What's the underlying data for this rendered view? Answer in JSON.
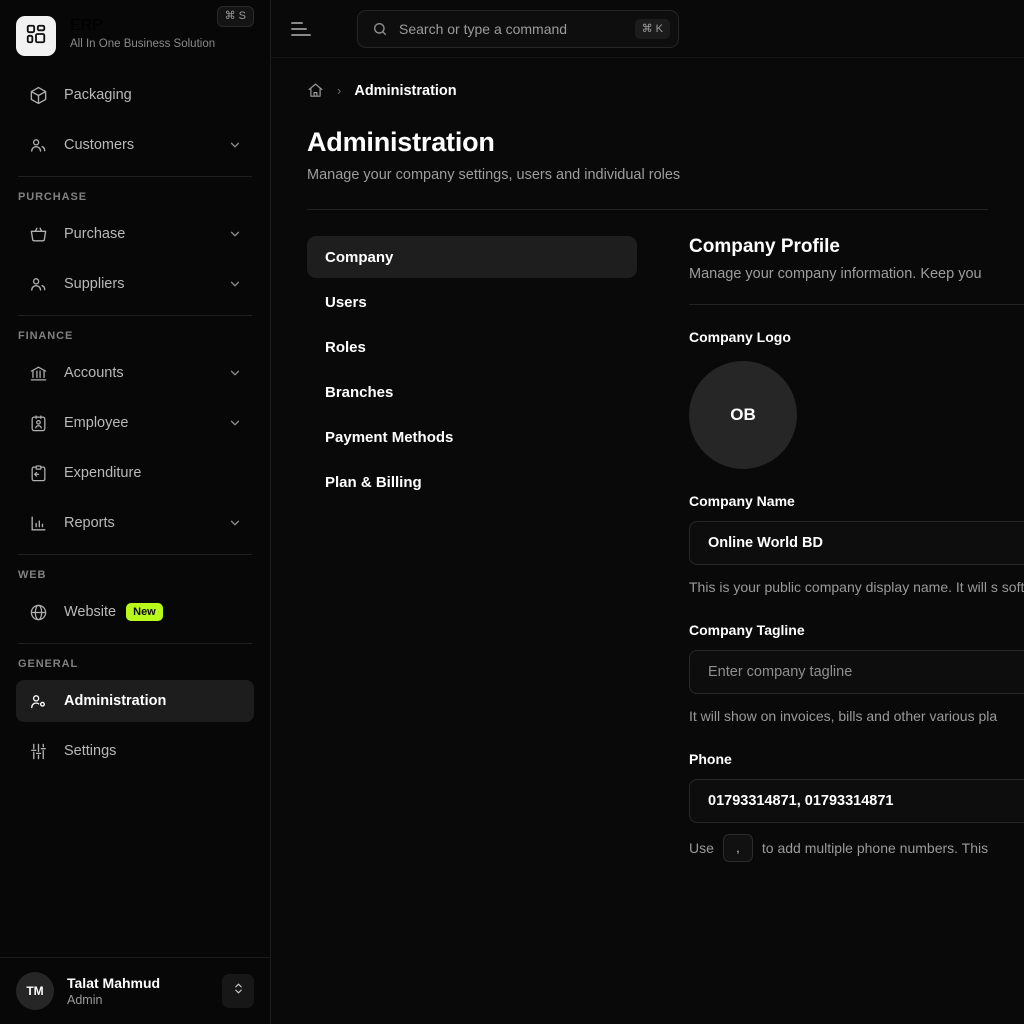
{
  "brand": {
    "title": "ERP",
    "subtitle": "All In One Business Solution",
    "shortcut_badge": "⌘ S",
    "logo_icon": "grid-blocks-icon"
  },
  "sidebar": {
    "top_items": [
      {
        "label": "Packaging",
        "icon": "package-icon",
        "expandable": false
      },
      {
        "label": "Customers",
        "icon": "users-icon",
        "expandable": true
      }
    ],
    "sections": [
      {
        "label": "PURCHASE",
        "items": [
          {
            "label": "Purchase",
            "icon": "basket-icon",
            "expandable": true
          },
          {
            "label": "Suppliers",
            "icon": "users-icon",
            "expandable": true
          }
        ]
      },
      {
        "label": "FINANCE",
        "items": [
          {
            "label": "Accounts",
            "icon": "bank-icon",
            "expandable": true
          },
          {
            "label": "Employee",
            "icon": "employee-badge-icon",
            "expandable": true
          },
          {
            "label": "Expenditure",
            "icon": "clipboard-arrow-icon",
            "expandable": false
          },
          {
            "label": "Reports",
            "icon": "bar-chart-icon",
            "expandable": true
          }
        ]
      },
      {
        "label": "WEB",
        "items": [
          {
            "label": "Website",
            "icon": "globe-icon",
            "expandable": false,
            "badge": "New"
          }
        ]
      },
      {
        "label": "GENERAL",
        "items": [
          {
            "label": "Administration",
            "icon": "user-gear-icon",
            "expandable": false,
            "active": true
          },
          {
            "label": "Settings",
            "icon": "sliders-icon",
            "expandable": false
          }
        ]
      }
    ],
    "user": {
      "initials": "TM",
      "name": "Talat Mahmud",
      "role": "Admin"
    }
  },
  "topbar": {
    "collapse_icon": "sidebar-collapse-icon",
    "search": {
      "placeholder": "Search or type a command",
      "value": "",
      "icon": "search-icon",
      "shortcut": "⌘ K"
    }
  },
  "breadcrumb": {
    "home_icon": "home-icon",
    "separator": "›",
    "current": "Administration"
  },
  "page": {
    "title": "Administration",
    "subtitle": "Manage your company settings, users and individual roles"
  },
  "tabs": [
    {
      "label": "Company",
      "active": true
    },
    {
      "label": "Users",
      "active": false
    },
    {
      "label": "Roles",
      "active": false
    },
    {
      "label": "Branches",
      "active": false
    },
    {
      "label": "Payment Methods",
      "active": false
    },
    {
      "label": "Plan & Billing",
      "active": false
    }
  ],
  "panel": {
    "title": "Company Profile",
    "subtitle": "Manage your company information. Keep you",
    "fields": {
      "logo": {
        "label": "Company Logo",
        "initials": "OB"
      },
      "company_name": {
        "label": "Company Name",
        "value": "Online World BD",
        "placeholder": "",
        "helper": "This is your public company display name. It will s software."
      },
      "tagline": {
        "label": "Company Tagline",
        "value": "",
        "placeholder": "Enter company tagline",
        "helper": "It will show on invoices, bills and other various pla"
      },
      "phone": {
        "label": "Phone",
        "value": "01793314871, 01793314871",
        "placeholder": "",
        "helper_prefix": "Use",
        "helper_key": ",",
        "helper_suffix": "to add multiple phone numbers. This"
      }
    }
  },
  "colors": {
    "background": "#000000",
    "sidebar_bg": "#070707",
    "main_bg": "#090909",
    "active_item": "#1e1e1e",
    "accent_badge": "#b9f81b",
    "text_primary": "#ffffff",
    "text_muted": "#9a9a9a",
    "border": "#232323"
  }
}
